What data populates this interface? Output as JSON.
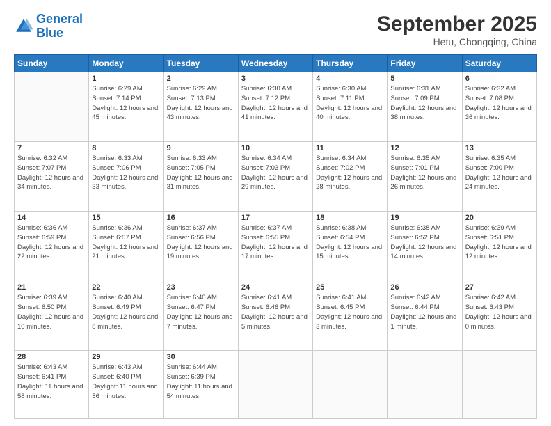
{
  "header": {
    "logo_line1": "General",
    "logo_line2": "Blue",
    "main_title": "September 2025",
    "subtitle": "Hetu, Chongqing, China"
  },
  "days_header": [
    "Sunday",
    "Monday",
    "Tuesday",
    "Wednesday",
    "Thursday",
    "Friday",
    "Saturday"
  ],
  "weeks": [
    [
      {
        "day": "",
        "sunrise": "",
        "sunset": "",
        "daylight": ""
      },
      {
        "day": "1",
        "sunrise": "Sunrise: 6:29 AM",
        "sunset": "Sunset: 7:14 PM",
        "daylight": "Daylight: 12 hours and 45 minutes."
      },
      {
        "day": "2",
        "sunrise": "Sunrise: 6:29 AM",
        "sunset": "Sunset: 7:13 PM",
        "daylight": "Daylight: 12 hours and 43 minutes."
      },
      {
        "day": "3",
        "sunrise": "Sunrise: 6:30 AM",
        "sunset": "Sunset: 7:12 PM",
        "daylight": "Daylight: 12 hours and 41 minutes."
      },
      {
        "day": "4",
        "sunrise": "Sunrise: 6:30 AM",
        "sunset": "Sunset: 7:11 PM",
        "daylight": "Daylight: 12 hours and 40 minutes."
      },
      {
        "day": "5",
        "sunrise": "Sunrise: 6:31 AM",
        "sunset": "Sunset: 7:09 PM",
        "daylight": "Daylight: 12 hours and 38 minutes."
      },
      {
        "day": "6",
        "sunrise": "Sunrise: 6:32 AM",
        "sunset": "Sunset: 7:08 PM",
        "daylight": "Daylight: 12 hours and 36 minutes."
      }
    ],
    [
      {
        "day": "7",
        "sunrise": "Sunrise: 6:32 AM",
        "sunset": "Sunset: 7:07 PM",
        "daylight": "Daylight: 12 hours and 34 minutes."
      },
      {
        "day": "8",
        "sunrise": "Sunrise: 6:33 AM",
        "sunset": "Sunset: 7:06 PM",
        "daylight": "Daylight: 12 hours and 33 minutes."
      },
      {
        "day": "9",
        "sunrise": "Sunrise: 6:33 AM",
        "sunset": "Sunset: 7:05 PM",
        "daylight": "Daylight: 12 hours and 31 minutes."
      },
      {
        "day": "10",
        "sunrise": "Sunrise: 6:34 AM",
        "sunset": "Sunset: 7:03 PM",
        "daylight": "Daylight: 12 hours and 29 minutes."
      },
      {
        "day": "11",
        "sunrise": "Sunrise: 6:34 AM",
        "sunset": "Sunset: 7:02 PM",
        "daylight": "Daylight: 12 hours and 28 minutes."
      },
      {
        "day": "12",
        "sunrise": "Sunrise: 6:35 AM",
        "sunset": "Sunset: 7:01 PM",
        "daylight": "Daylight: 12 hours and 26 minutes."
      },
      {
        "day": "13",
        "sunrise": "Sunrise: 6:35 AM",
        "sunset": "Sunset: 7:00 PM",
        "daylight": "Daylight: 12 hours and 24 minutes."
      }
    ],
    [
      {
        "day": "14",
        "sunrise": "Sunrise: 6:36 AM",
        "sunset": "Sunset: 6:59 PM",
        "daylight": "Daylight: 12 hours and 22 minutes."
      },
      {
        "day": "15",
        "sunrise": "Sunrise: 6:36 AM",
        "sunset": "Sunset: 6:57 PM",
        "daylight": "Daylight: 12 hours and 21 minutes."
      },
      {
        "day": "16",
        "sunrise": "Sunrise: 6:37 AM",
        "sunset": "Sunset: 6:56 PM",
        "daylight": "Daylight: 12 hours and 19 minutes."
      },
      {
        "day": "17",
        "sunrise": "Sunrise: 6:37 AM",
        "sunset": "Sunset: 6:55 PM",
        "daylight": "Daylight: 12 hours and 17 minutes."
      },
      {
        "day": "18",
        "sunrise": "Sunrise: 6:38 AM",
        "sunset": "Sunset: 6:54 PM",
        "daylight": "Daylight: 12 hours and 15 minutes."
      },
      {
        "day": "19",
        "sunrise": "Sunrise: 6:38 AM",
        "sunset": "Sunset: 6:52 PM",
        "daylight": "Daylight: 12 hours and 14 minutes."
      },
      {
        "day": "20",
        "sunrise": "Sunrise: 6:39 AM",
        "sunset": "Sunset: 6:51 PM",
        "daylight": "Daylight: 12 hours and 12 minutes."
      }
    ],
    [
      {
        "day": "21",
        "sunrise": "Sunrise: 6:39 AM",
        "sunset": "Sunset: 6:50 PM",
        "daylight": "Daylight: 12 hours and 10 minutes."
      },
      {
        "day": "22",
        "sunrise": "Sunrise: 6:40 AM",
        "sunset": "Sunset: 6:49 PM",
        "daylight": "Daylight: 12 hours and 8 minutes."
      },
      {
        "day": "23",
        "sunrise": "Sunrise: 6:40 AM",
        "sunset": "Sunset: 6:47 PM",
        "daylight": "Daylight: 12 hours and 7 minutes."
      },
      {
        "day": "24",
        "sunrise": "Sunrise: 6:41 AM",
        "sunset": "Sunset: 6:46 PM",
        "daylight": "Daylight: 12 hours and 5 minutes."
      },
      {
        "day": "25",
        "sunrise": "Sunrise: 6:41 AM",
        "sunset": "Sunset: 6:45 PM",
        "daylight": "Daylight: 12 hours and 3 minutes."
      },
      {
        "day": "26",
        "sunrise": "Sunrise: 6:42 AM",
        "sunset": "Sunset: 6:44 PM",
        "daylight": "Daylight: 12 hours and 1 minute."
      },
      {
        "day": "27",
        "sunrise": "Sunrise: 6:42 AM",
        "sunset": "Sunset: 6:43 PM",
        "daylight": "Daylight: 12 hours and 0 minutes."
      }
    ],
    [
      {
        "day": "28",
        "sunrise": "Sunrise: 6:43 AM",
        "sunset": "Sunset: 6:41 PM",
        "daylight": "Daylight: 11 hours and 58 minutes."
      },
      {
        "day": "29",
        "sunrise": "Sunrise: 6:43 AM",
        "sunset": "Sunset: 6:40 PM",
        "daylight": "Daylight: 11 hours and 56 minutes."
      },
      {
        "day": "30",
        "sunrise": "Sunrise: 6:44 AM",
        "sunset": "Sunset: 6:39 PM",
        "daylight": "Daylight: 11 hours and 54 minutes."
      },
      {
        "day": "",
        "sunrise": "",
        "sunset": "",
        "daylight": ""
      },
      {
        "day": "",
        "sunrise": "",
        "sunset": "",
        "daylight": ""
      },
      {
        "day": "",
        "sunrise": "",
        "sunset": "",
        "daylight": ""
      },
      {
        "day": "",
        "sunrise": "",
        "sunset": "",
        "daylight": ""
      }
    ]
  ]
}
